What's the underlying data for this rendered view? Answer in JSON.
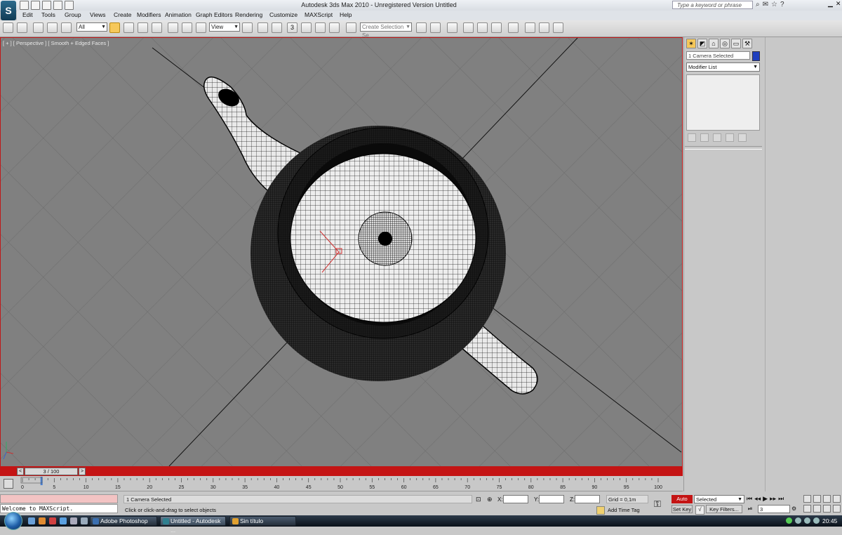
{
  "window": {
    "title": "Autodesk 3ds Max  2010   - Unregistered Version    Untitled",
    "logo": "S",
    "search_placeholder": "Type a keyword or phrase"
  },
  "menu": [
    "Edit",
    "Tools",
    "Group",
    "Views",
    "Create",
    "Modifiers",
    "Animation",
    "Graph Editors",
    "Rendering",
    "Customize",
    "MAXScript",
    "Help"
  ],
  "toolbar": {
    "selection_filter": "All",
    "ref_coord": "View",
    "named_selection_placeholder": "Create Selection Se",
    "snap_label": "3"
  },
  "viewport": {
    "label": "[ + ] [ Perspective ] [ Smooth + Edged Faces ]",
    "background": "#808080"
  },
  "command_panel": {
    "object_name": "1 Camera Selected",
    "object_color": "#1f3fbf",
    "modifier_list": "Modifier List"
  },
  "timeline": {
    "frame_display": "3 / 100",
    "current_frame": 3,
    "total_frames": 100,
    "ticks": [
      "0",
      "5",
      "10",
      "15",
      "20",
      "25",
      "30",
      "35",
      "40",
      "45",
      "50",
      "55",
      "60",
      "65",
      "70",
      "75",
      "80",
      "85",
      "90",
      "95",
      "100"
    ]
  },
  "status": {
    "maxscript_welcome": "Welcome to MAXScript.",
    "selection_text": "1 Camera Selected",
    "prompt": "Click or click-and-drag to select objects",
    "x_label": "X:",
    "y_label": "Y:",
    "z_label": "Z:",
    "grid": "Grid = 0,1m",
    "add_time_tag": "Add Time Tag",
    "auto_key": "Auto Key",
    "set_key": "Set Key",
    "key_mode": "Selected",
    "key_filters": "Key Filters...",
    "frame_field": "3"
  },
  "taskbar": {
    "buttons": [
      "Adobe Photoshop",
      "Untitled - Autodesk ...",
      "Sin título"
    ],
    "clock": "20:45"
  },
  "colors": {
    "active_border": "#c01818",
    "time_slider": "#c41414",
    "active_tool": "#f6c85a"
  }
}
